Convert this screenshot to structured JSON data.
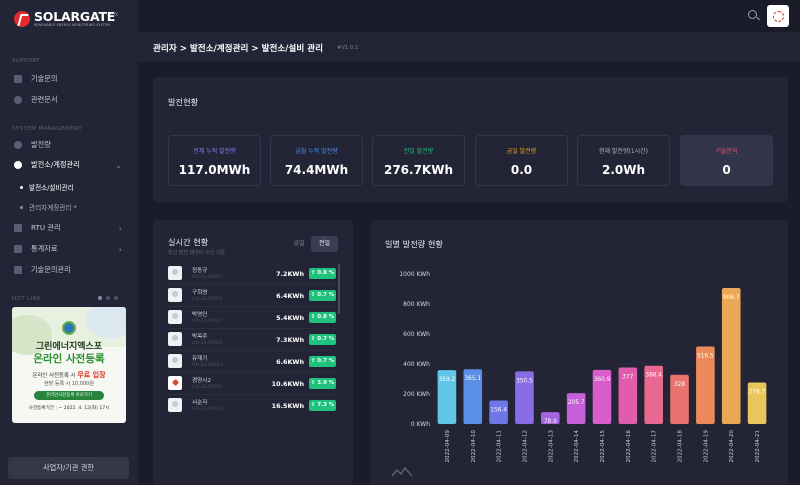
{
  "brand": {
    "name": "SOLARGATE",
    "tagline": "RENEWABLE ENERGY MONITORING SYSTEM"
  },
  "sidebar": {
    "support_label": "SUPPORT",
    "support_items": [
      {
        "label": "기술문의",
        "icon": "chat-icon"
      },
      {
        "label": "관련문서",
        "icon": "document-icon"
      }
    ],
    "system_label": "SYSTEM MANAGEMENT",
    "system_items": [
      {
        "label": "발전량",
        "icon": "chart-icon"
      },
      {
        "label": "발전소/계정관리",
        "icon": "settings-icon",
        "expanded": true
      },
      {
        "label": "RTU 관리",
        "icon": "rtu-icon"
      },
      {
        "label": "통계자료",
        "icon": "stats-icon"
      },
      {
        "label": "기술문의관리",
        "icon": "support-icon"
      }
    ],
    "sub_items": [
      {
        "label": "발전소/설비관리",
        "active": true
      },
      {
        "label": "관리자계정관리 *",
        "active": false
      }
    ],
    "hot_link_label": "HOT LINK",
    "banner": {
      "title1": "그린에너지엑스포",
      "title2": "온라인 사전등록",
      "line1_prefix": "온라인 사전등록 시",
      "line1_highlight": "무료 입장",
      "line2": "현장 등록 시 10,000원",
      "button": "온라인사전등록 바로가기",
      "deadline": "사전등록기간 : ~ 2022. 4. 12(화) 17시"
    },
    "bottom_button": "사업자/기관 권한"
  },
  "header": {
    "avatar_icon": "solar-logo-icon"
  },
  "page": {
    "title": "관리자 > 발전소/계정관리 > 발전소/설비 관리",
    "version": "#V1.0.1"
  },
  "overview": {
    "title": "발전현황",
    "stats": [
      {
        "label": "전체 누적 발전량",
        "value": "117.0MWh",
        "color": "#8d7bf5"
      },
      {
        "label": "금월 누적 발전량",
        "value": "74.4MWh",
        "color": "#4a90f5"
      },
      {
        "label": "전일 발전량",
        "value": "276.7KWh",
        "color": "#1ec27c"
      },
      {
        "label": "금일 발전량",
        "value": "0.0",
        "color": "#f5a623"
      },
      {
        "label": "현재 발전량(1시간)",
        "value": "2.0Wh",
        "color": "#b5b7c6"
      },
      {
        "label": "기술문의",
        "value": "0",
        "color": "#f0556b"
      }
    ]
  },
  "realtime": {
    "title": "실시간 현황",
    "subtitle": "최신 발전 데이터 수신 기준",
    "toggle_today": "금일",
    "toggle_yesterday": "전일",
    "rows": [
      {
        "name": "정동규",
        "code": "HD-22-00007",
        "value": "7.2KWh",
        "change": "0.8 %"
      },
      {
        "name": "구희영",
        "code": "HD-22-00005",
        "value": "6.4KWh",
        "change": "0.7 %"
      },
      {
        "name": "박영인",
        "code": "HD-22-00017",
        "value": "5.4KWh",
        "change": "0.8 %"
      },
      {
        "name": "박옥주",
        "code": "HD-22-00002",
        "value": "7.3KWh",
        "change": "0.7 %"
      },
      {
        "name": "유재기",
        "code": "HD-22-00013",
        "value": "6.6KWh",
        "change": "0.7 %"
      },
      {
        "name": "경양시2",
        "code": "HD-22-00022",
        "value": "10.6KWh",
        "change": "3.9 %"
      },
      {
        "name": "서순자",
        "code": "HD-22-00011",
        "value": "16.5KWh",
        "change": "7.3 %"
      }
    ]
  },
  "daily": {
    "title": "일별 발전량 현황"
  },
  "chart_data": {
    "type": "bar",
    "title": "일별 발전량 현황",
    "xlabel": "",
    "ylabel": "",
    "ylim": [
      0,
      1000
    ],
    "yticks": [
      "0 KWh",
      "200 KWh",
      "400 KWh",
      "600 KWh",
      "800 KWh",
      "1000 KWh"
    ],
    "categories": [
      "2022-04-09",
      "2022-04-10",
      "2022-04-11",
      "2022-04-12",
      "2022-04-13",
      "2022-04-14",
      "2022-04-15",
      "2022-04-16",
      "2022-04-17",
      "2022-04-18",
      "2022-04-19",
      "2022-04-20",
      "2022-04-21"
    ],
    "values": [
      359.2,
      365.1,
      156.4,
      350.5,
      78.9,
      205.7,
      360.9,
      377,
      388.4,
      328,
      516.5,
      906.7,
      276.7
    ],
    "colors": [
      "#5fc6e8",
      "#5b8fe6",
      "#6f77e6",
      "#8a6ce6",
      "#a565e0",
      "#c560d8",
      "#d95ccc",
      "#e05dae",
      "#e86890",
      "#ea7370",
      "#ec8a5c",
      "#eaa855",
      "#e8c65c"
    ],
    "grid": true
  }
}
